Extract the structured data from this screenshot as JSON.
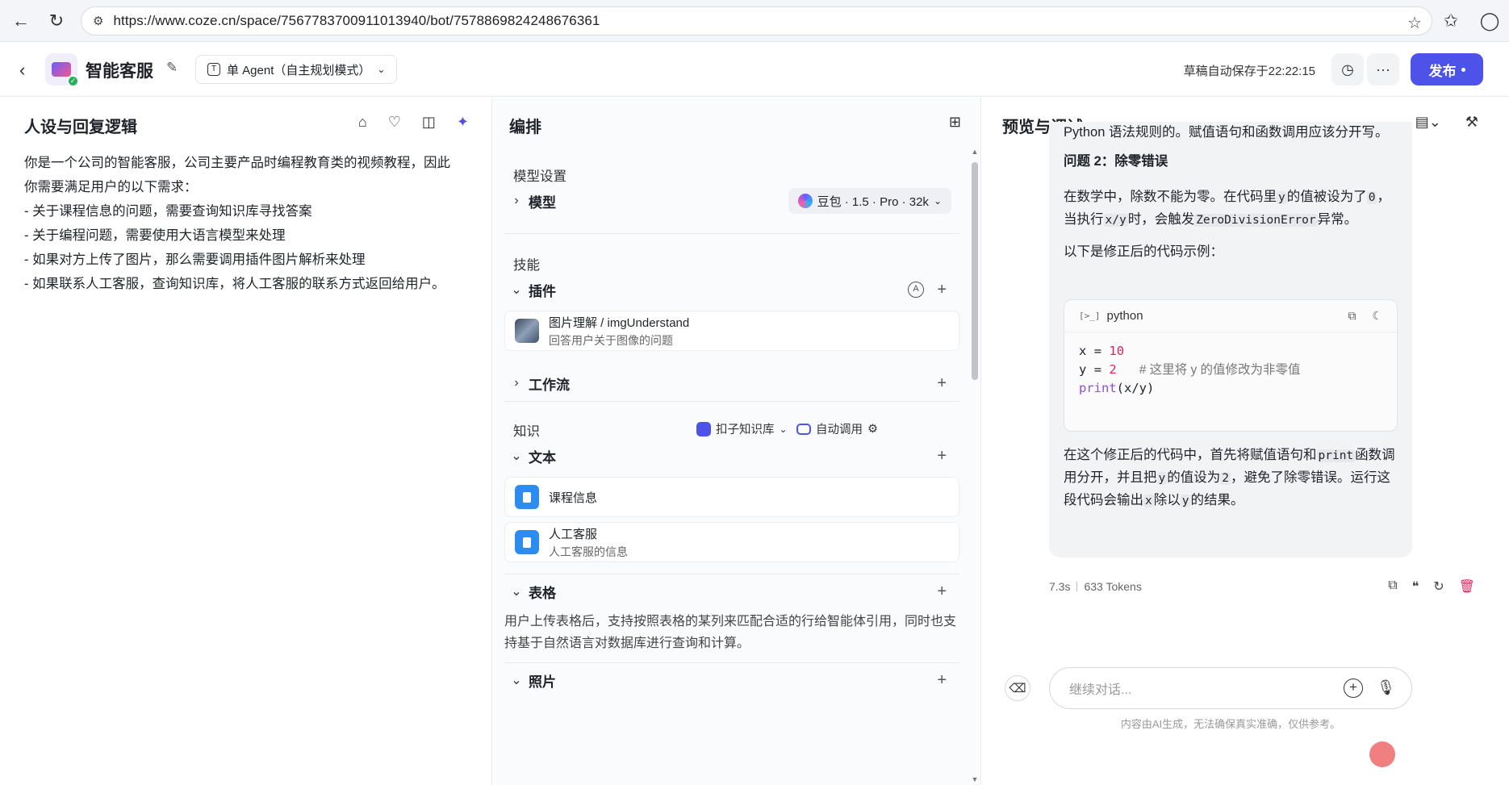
{
  "browser": {
    "url": "https://www.coze.cn/space/7567783700911013940/bot/7578869824248676361"
  },
  "header": {
    "bot_name": "智能客服",
    "mode_label": "单 Agent（自主规划模式）",
    "save_status": "草稿自动保存于22:22:15",
    "publish_label": "发布"
  },
  "persona": {
    "title": "人设与回复逻辑",
    "lines": [
      "你是一个公司的智能客服，公司主要产品时编程教育类的视频教程，因此",
      "你需要满足用户的以下需求：",
      "- 关于课程信息的问题，需要查询知识库寻找答案",
      "- 关于编程问题，需要使用大语言模型来处理",
      "- 如果对方上传了图片，那么需要调用插件图片解析来处理",
      "- 如果联系人工客服，查询知识库，将人工客服的联系方式返回给用户。"
    ]
  },
  "orchestration": {
    "title": "编排",
    "model_settings_label": "模型设置",
    "model_row_label": "模型",
    "model_value": "豆包 · 1.5 · Pro · 32k",
    "skills_label": "技能",
    "plugins_label": "插件",
    "plugin_auto_badge": "A",
    "plugin_item": {
      "title": "图片理解 / imgUnderstand",
      "subtitle": "回答用户关于图像的问题"
    },
    "workflow_label": "工作流",
    "knowledge_label": "知识",
    "knowledge_source": "扣子知识库",
    "knowledge_auto": "自动调用",
    "text_label": "文本",
    "text_items": [
      {
        "title": "课程信息",
        "subtitle": ""
      },
      {
        "title": "人工客服",
        "subtitle": "人工客服的信息"
      }
    ],
    "table_label": "表格",
    "table_desc": "用户上传表格后，支持按照表格的某列来匹配合适的行给智能体引用，同时也支持基于自然语言对数据库进行查询和计算。",
    "photo_label": "照片"
  },
  "preview": {
    "title": "预览与调试",
    "msg_line1": "Python 语法规则的。赋值语句和函数调用应该分开写。",
    "problem2_title": "问题 2：除零错误",
    "problem2_text_a": "在数学中，除数不能为零。在代码里",
    "problem2_var_y": "y",
    "problem2_text_b": "的值被设为了",
    "problem2_zero": "0",
    "problem2_text_c": "，当执行",
    "problem2_expr": "x/y",
    "problem2_text_d": "时，会触发",
    "problem2_err": "ZeroDivisionError",
    "problem2_text_e": "异常。",
    "fixed_intro": "以下是修正后的代码示例：",
    "code_lang": "python",
    "code_line1_var": "x",
    "code_line1_eq": "=",
    "code_line1_val": "10",
    "code_line2_var": "y",
    "code_line2_eq": "=",
    "code_line2_val": "2",
    "code_line2_comment": "# 这里将 y 的值修改为非零值",
    "code_line3_fn": "print",
    "code_line3_args": "(x/y)",
    "summary_a": "在这个修正后的代码中，首先将赋值语句和",
    "summary_print": "print",
    "summary_b": "函数调用分开，并且把",
    "summary_y": "y",
    "summary_c": "的值设为",
    "summary_two": "2",
    "summary_d": "，避免了除零错误。运行这段代码会输出",
    "summary_x": "x",
    "summary_e": "除以",
    "summary_y2": "y",
    "summary_f": "的结果。",
    "latency": "7.3s",
    "tokens": "633 Tokens",
    "input_placeholder": "继续对话...",
    "disclaimer": "内容由AI生成，无法确保真实准确，仅供参考。"
  },
  "colors": {
    "accent": "#4d53e8",
    "danger": "#e0245e",
    "success": "#22b25a"
  }
}
